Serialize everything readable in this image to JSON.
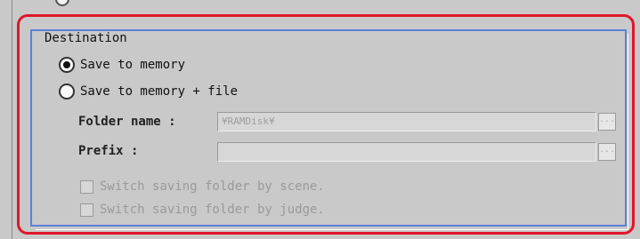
{
  "group": {
    "title": "Destination"
  },
  "radios": [
    {
      "label": "Save to memory",
      "checked": true
    },
    {
      "label": "Save to memory + file",
      "checked": false
    }
  ],
  "fields": {
    "folder_name": {
      "label": "Folder name :",
      "value": "¥RAMDisk¥"
    },
    "prefix": {
      "label": "Prefix :",
      "value": ""
    }
  },
  "browse_label": "...",
  "checkboxes": [
    {
      "label": "Switch saving folder by scene.",
      "checked": false
    },
    {
      "label": "Switch saving folder by judge.",
      "checked": false
    }
  ],
  "colors": {
    "highlight": "#e0162a",
    "group_border": "#5d7fd9",
    "panel_bg": "#c9c9c9"
  }
}
